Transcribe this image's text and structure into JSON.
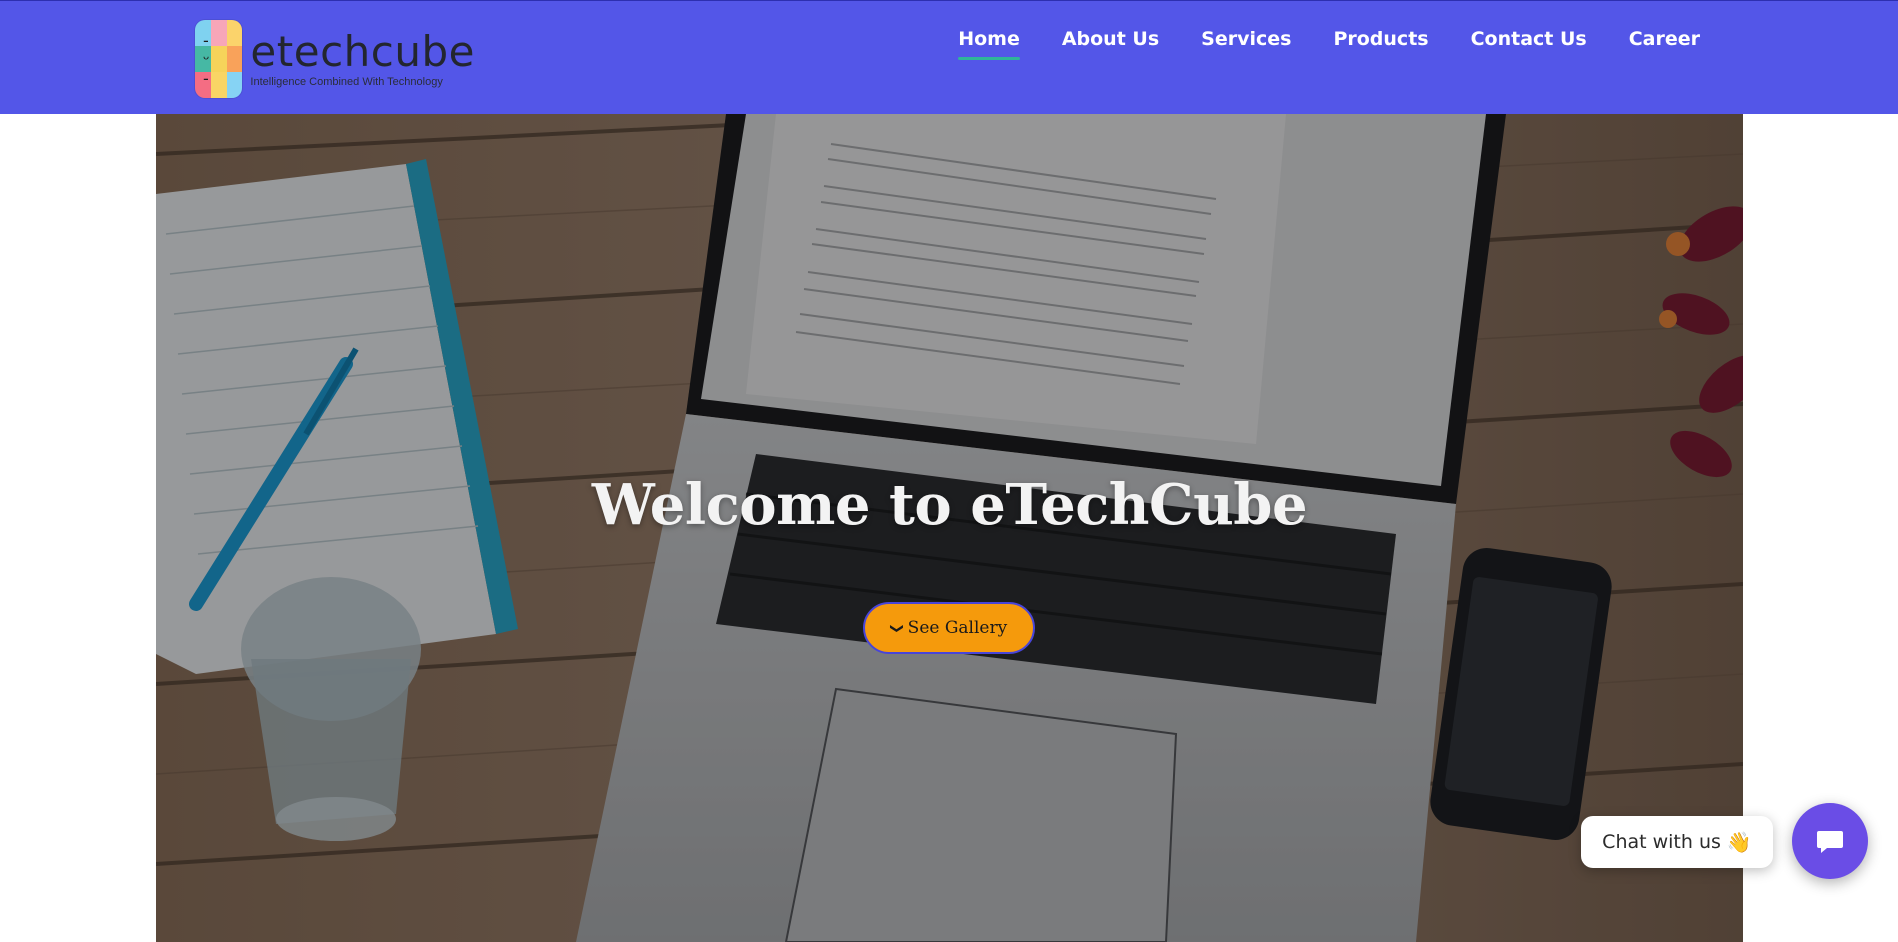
{
  "brand": {
    "name": "etechcube",
    "tagline": "Intelligence Combined With Technology",
    "face": "- ᵕ -"
  },
  "nav": {
    "items": [
      {
        "label": "Home",
        "active": true
      },
      {
        "label": "About Us",
        "active": false
      },
      {
        "label": "Services",
        "active": false
      },
      {
        "label": "Products",
        "active": false
      },
      {
        "label": "Contact Us",
        "active": false
      },
      {
        "label": "Career",
        "active": false
      }
    ]
  },
  "hero": {
    "title": "Welcome to eTechCube",
    "button_label": "See Gallery",
    "button_icon": "chevron-down-icon",
    "background_image": "laptop-on-wooden-desk-photo"
  },
  "chat": {
    "prompt": "Chat with us",
    "wave_emoji": "👋",
    "launcher_icon": "chat-bubble-icon"
  },
  "colors": {
    "navbar": "#5356e8",
    "nav_active_underline": "#2fb59a",
    "button_bg": "#f59a0c",
    "button_border": "#4845d9",
    "chat_launcher": "#6a4de6"
  }
}
